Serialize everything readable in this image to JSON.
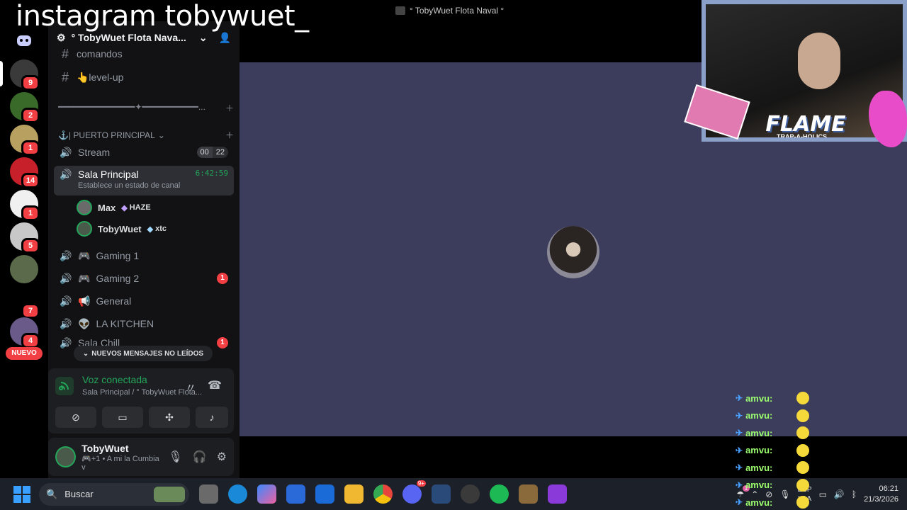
{
  "overlay": {
    "instagram": "instagram tobywuet_"
  },
  "window": {
    "title": "° TobyWuet Flota Naval °"
  },
  "rail": {
    "badges": [
      "9",
      "2",
      "1",
      "14",
      "1",
      "5",
      "7",
      "4"
    ],
    "new_label": "NUEVO"
  },
  "sidebar": {
    "guild_name": "° TobyWuet Flota Nava...",
    "channels_top": [
      {
        "name": "comandos"
      },
      {
        "name": "👆level-up"
      }
    ],
    "divider_label": "━━━━━━━━━━━━━━━✦━━━━━━━━━━━...",
    "category": "⚓| PUERTO PRINCIPAL",
    "voice_channels": [
      {
        "name": "Stream",
        "count_a": "00",
        "count_b": "22"
      },
      {
        "name": "Sala Principal",
        "timer": "6:42:59",
        "status": "Establece un estado de canal"
      },
      {
        "name": "Gaming 1"
      },
      {
        "name": "Gaming 2",
        "badge": "1"
      },
      {
        "name": "General"
      },
      {
        "name": "LA KITCHEN"
      },
      {
        "name": "Sala Chill",
        "badge": "1"
      }
    ],
    "members": [
      {
        "name": "Max",
        "tag": "HAZE"
      },
      {
        "name": "TobyWuet",
        "tag": "xtc"
      }
    ],
    "new_messages": "NUEVOS MENSAJES NO LEÍDOS"
  },
  "voice": {
    "status": "Voz conectada",
    "location": "Sala Principal / ° TobyWuet Flota..."
  },
  "user": {
    "name": "TobyWuet",
    "status": "🎮+1 • A mi la Cumbia v"
  },
  "webcam": {
    "brand": "FLAME",
    "sub": "TRAP-A-HOLICS"
  },
  "chat": {
    "lines": [
      "amvu:",
      "amvu:",
      "amvu:",
      "amvu:",
      "amvu:",
      "amvu:",
      "amvu:"
    ]
  },
  "taskbar": {
    "search_placeholder": "Buscar",
    "lang_top": "ESP",
    "lang_bottom": "LAA",
    "time": "06:21",
    "date": "21/3/2026",
    "notif_count": "1",
    "discord_badge": "9+"
  },
  "colors": {
    "accent_green": "#23a55a",
    "badge_red": "#f23f43",
    "stage_bg": "#3c3d5c"
  }
}
